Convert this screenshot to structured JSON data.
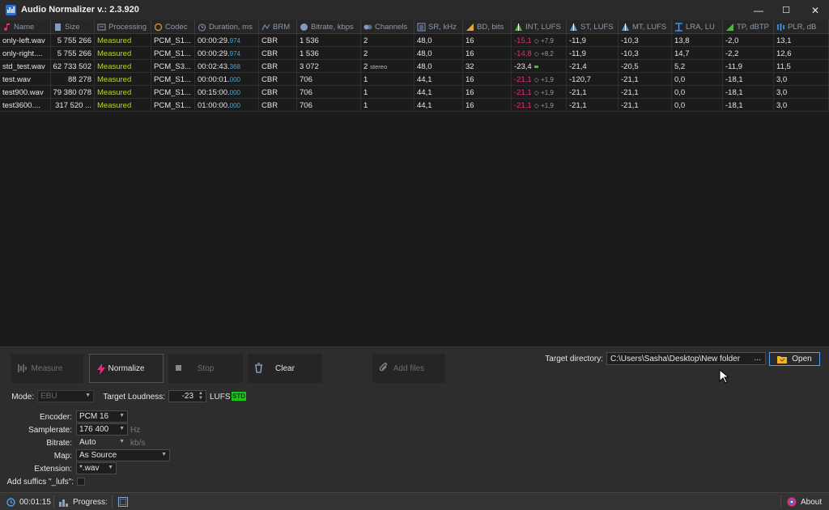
{
  "window": {
    "title": "Audio Normalizer v.: 2.3.920",
    "minimize": "—",
    "maximize": "☐",
    "close": "✕"
  },
  "columns": [
    {
      "key": "name",
      "label": "Name",
      "icon": "music-note-icon",
      "color": "#e0307a"
    },
    {
      "key": "size",
      "label": "Size",
      "icon": "file-icon",
      "color": "#7f9bbf"
    },
    {
      "key": "processing",
      "label": "Processing",
      "icon": "processing-icon",
      "color": "#7f9bbf"
    },
    {
      "key": "codec",
      "label": "Codec",
      "icon": "codec-icon",
      "color": "#d98b2b"
    },
    {
      "key": "duration",
      "label": "Duration, ms",
      "icon": "stopwatch-icon",
      "color": "#7f9bbf"
    },
    {
      "key": "brm",
      "label": "BRM",
      "icon": "brm-icon",
      "color": "#7f9bbf"
    },
    {
      "key": "bitrate",
      "label": "Bitrate, kbps",
      "icon": "bitrate-icon",
      "color": "#7f9bbf"
    },
    {
      "key": "channels",
      "label": "Channels",
      "icon": "channels-icon",
      "color": "#7f9bbf"
    },
    {
      "key": "sr",
      "label": "SR, kHz",
      "icon": "samplerate-icon",
      "color": "#7f9bbf"
    },
    {
      "key": "bd",
      "label": "BD, bits",
      "icon": "bitdepth-icon",
      "color": "#e6a52b"
    },
    {
      "key": "int",
      "label": "INT, LUFS",
      "icon": "int-lufs-icon",
      "color": "#42c02e"
    },
    {
      "key": "st",
      "label": "ST, LUFS",
      "icon": "st-lufs-icon",
      "color": "#4aa3ff"
    },
    {
      "key": "mt",
      "label": "MT, LUFS",
      "icon": "mt-lufs-icon",
      "color": "#4aa3ff"
    },
    {
      "key": "lra",
      "label": "LRA, LU",
      "icon": "lra-icon",
      "color": "#4aa3ff"
    },
    {
      "key": "tp",
      "label": "TP, dBTP",
      "icon": "tp-icon",
      "color": "#42c02e"
    },
    {
      "key": "plr",
      "label": "PLR, dB",
      "icon": "plr-icon",
      "color": "#4aa3ff"
    }
  ],
  "rows": [
    {
      "name": "only-left.wav",
      "size": "5 755 266",
      "processing": "Measured",
      "codec": "PCM_S1...",
      "duration": "00:00:29.",
      "duration_ms": "974",
      "brm": "CBR",
      "bitrate": "1 536",
      "channels": "2",
      "channels_note": "",
      "sr": "48,0",
      "bd": "16",
      "int": "-15,1",
      "int_delta": "◇ +7,9",
      "st": "-11,9",
      "mt": "-10,3",
      "lra": "13,8",
      "tp": "-2,0",
      "plr": "13,1"
    },
    {
      "name": "only-right....",
      "size": "5 755 266",
      "processing": "Measured",
      "codec": "PCM_S1...",
      "duration": "00:00:29.",
      "duration_ms": "974",
      "brm": "CBR",
      "bitrate": "1 536",
      "channels": "2",
      "channels_note": "",
      "sr": "48,0",
      "bd": "16",
      "int": "-14,8",
      "int_delta": "◇ +8,2",
      "st": "-11,9",
      "mt": "-10,3",
      "lra": "14,7",
      "tp": "-2,2",
      "plr": "12,6"
    },
    {
      "name": "std_test.wav",
      "size": "62 733 502",
      "processing": "Measured",
      "codec": "PCM_S3...",
      "duration": "00:02:43.",
      "duration_ms": "368",
      "brm": "CBR",
      "bitrate": "3 072",
      "channels": "2",
      "channels_note": "stereo",
      "sr": "48,0",
      "bd": "32",
      "int": "-23,4",
      "int_delta": "",
      "st": "-21,4",
      "mt": "-20,5",
      "lra": "5,2",
      "tp": "-11,9",
      "plr": "11,5"
    },
    {
      "name": "test.wav",
      "size": "88 278",
      "processing": "Measured",
      "codec": "PCM_S1...",
      "duration": "00:00:01.",
      "duration_ms": "000",
      "brm": "CBR",
      "bitrate": "706",
      "channels": "1",
      "channels_note": "",
      "sr": "44,1",
      "bd": "16",
      "int": "-21,1",
      "int_delta": "◇ +1,9",
      "st": "-120,7",
      "mt": "-21,1",
      "lra": "0,0",
      "tp": "-18,1",
      "plr": "3,0"
    },
    {
      "name": "test900.wav",
      "size": "79 380 078",
      "processing": "Measured",
      "codec": "PCM_S1...",
      "duration": "00:15:00.",
      "duration_ms": "000",
      "brm": "CBR",
      "bitrate": "706",
      "channels": "1",
      "channels_note": "",
      "sr": "44,1",
      "bd": "16",
      "int": "-21,1",
      "int_delta": "◇ +1,9",
      "st": "-21,1",
      "mt": "-21,1",
      "lra": "0,0",
      "tp": "-18,1",
      "plr": "3,0"
    },
    {
      "name": "test3600....",
      "size": "317 520 ...",
      "processing": "Measured",
      "codec": "PCM_S1...",
      "duration": "01:00:00.",
      "duration_ms": "000",
      "brm": "CBR",
      "bitrate": "706",
      "channels": "1",
      "channels_note": "",
      "sr": "44,1",
      "bd": "16",
      "int": "-21,1",
      "int_delta": "◇ +1,9",
      "st": "-21,1",
      "mt": "-21,1",
      "lra": "0,0",
      "tp": "-18,1",
      "plr": "3,0"
    }
  ],
  "actions": {
    "measure": "Measure",
    "normalize": "Normalize",
    "stop": "Stop",
    "clear": "Clear",
    "add_files": "Add files"
  },
  "target_directory": {
    "label": "Target directory:",
    "value": "C:\\Users\\Sasha\\Desktop\\New folder",
    "browse": "...",
    "open": "Open"
  },
  "settings": {
    "mode_label": "Mode:",
    "mode_value": "EBU",
    "target_loudness_label": "Target Loudness:",
    "target_loudness_value": "-23",
    "target_loudness_unit": "LUFS",
    "std_badge": "STD",
    "encoder_label": "Encoder:",
    "encoder_value": "PCM 16",
    "samplerate_label": "Samplerate:",
    "samplerate_value": "176 400",
    "samplerate_unit": "Hz",
    "bitrate_label": "Bitrate:",
    "bitrate_value": "Auto",
    "bitrate_unit": "kb/s",
    "map_label": "Map:",
    "map_value": "As Source",
    "extension_label": "Extension:",
    "extension_value": "*.wav",
    "suffix_label": "Add suffics \"_lufs\":",
    "suffix_checked": false
  },
  "statusbar": {
    "elapsed": "00:01:15",
    "progress_label": "Progress:",
    "about": "About"
  }
}
